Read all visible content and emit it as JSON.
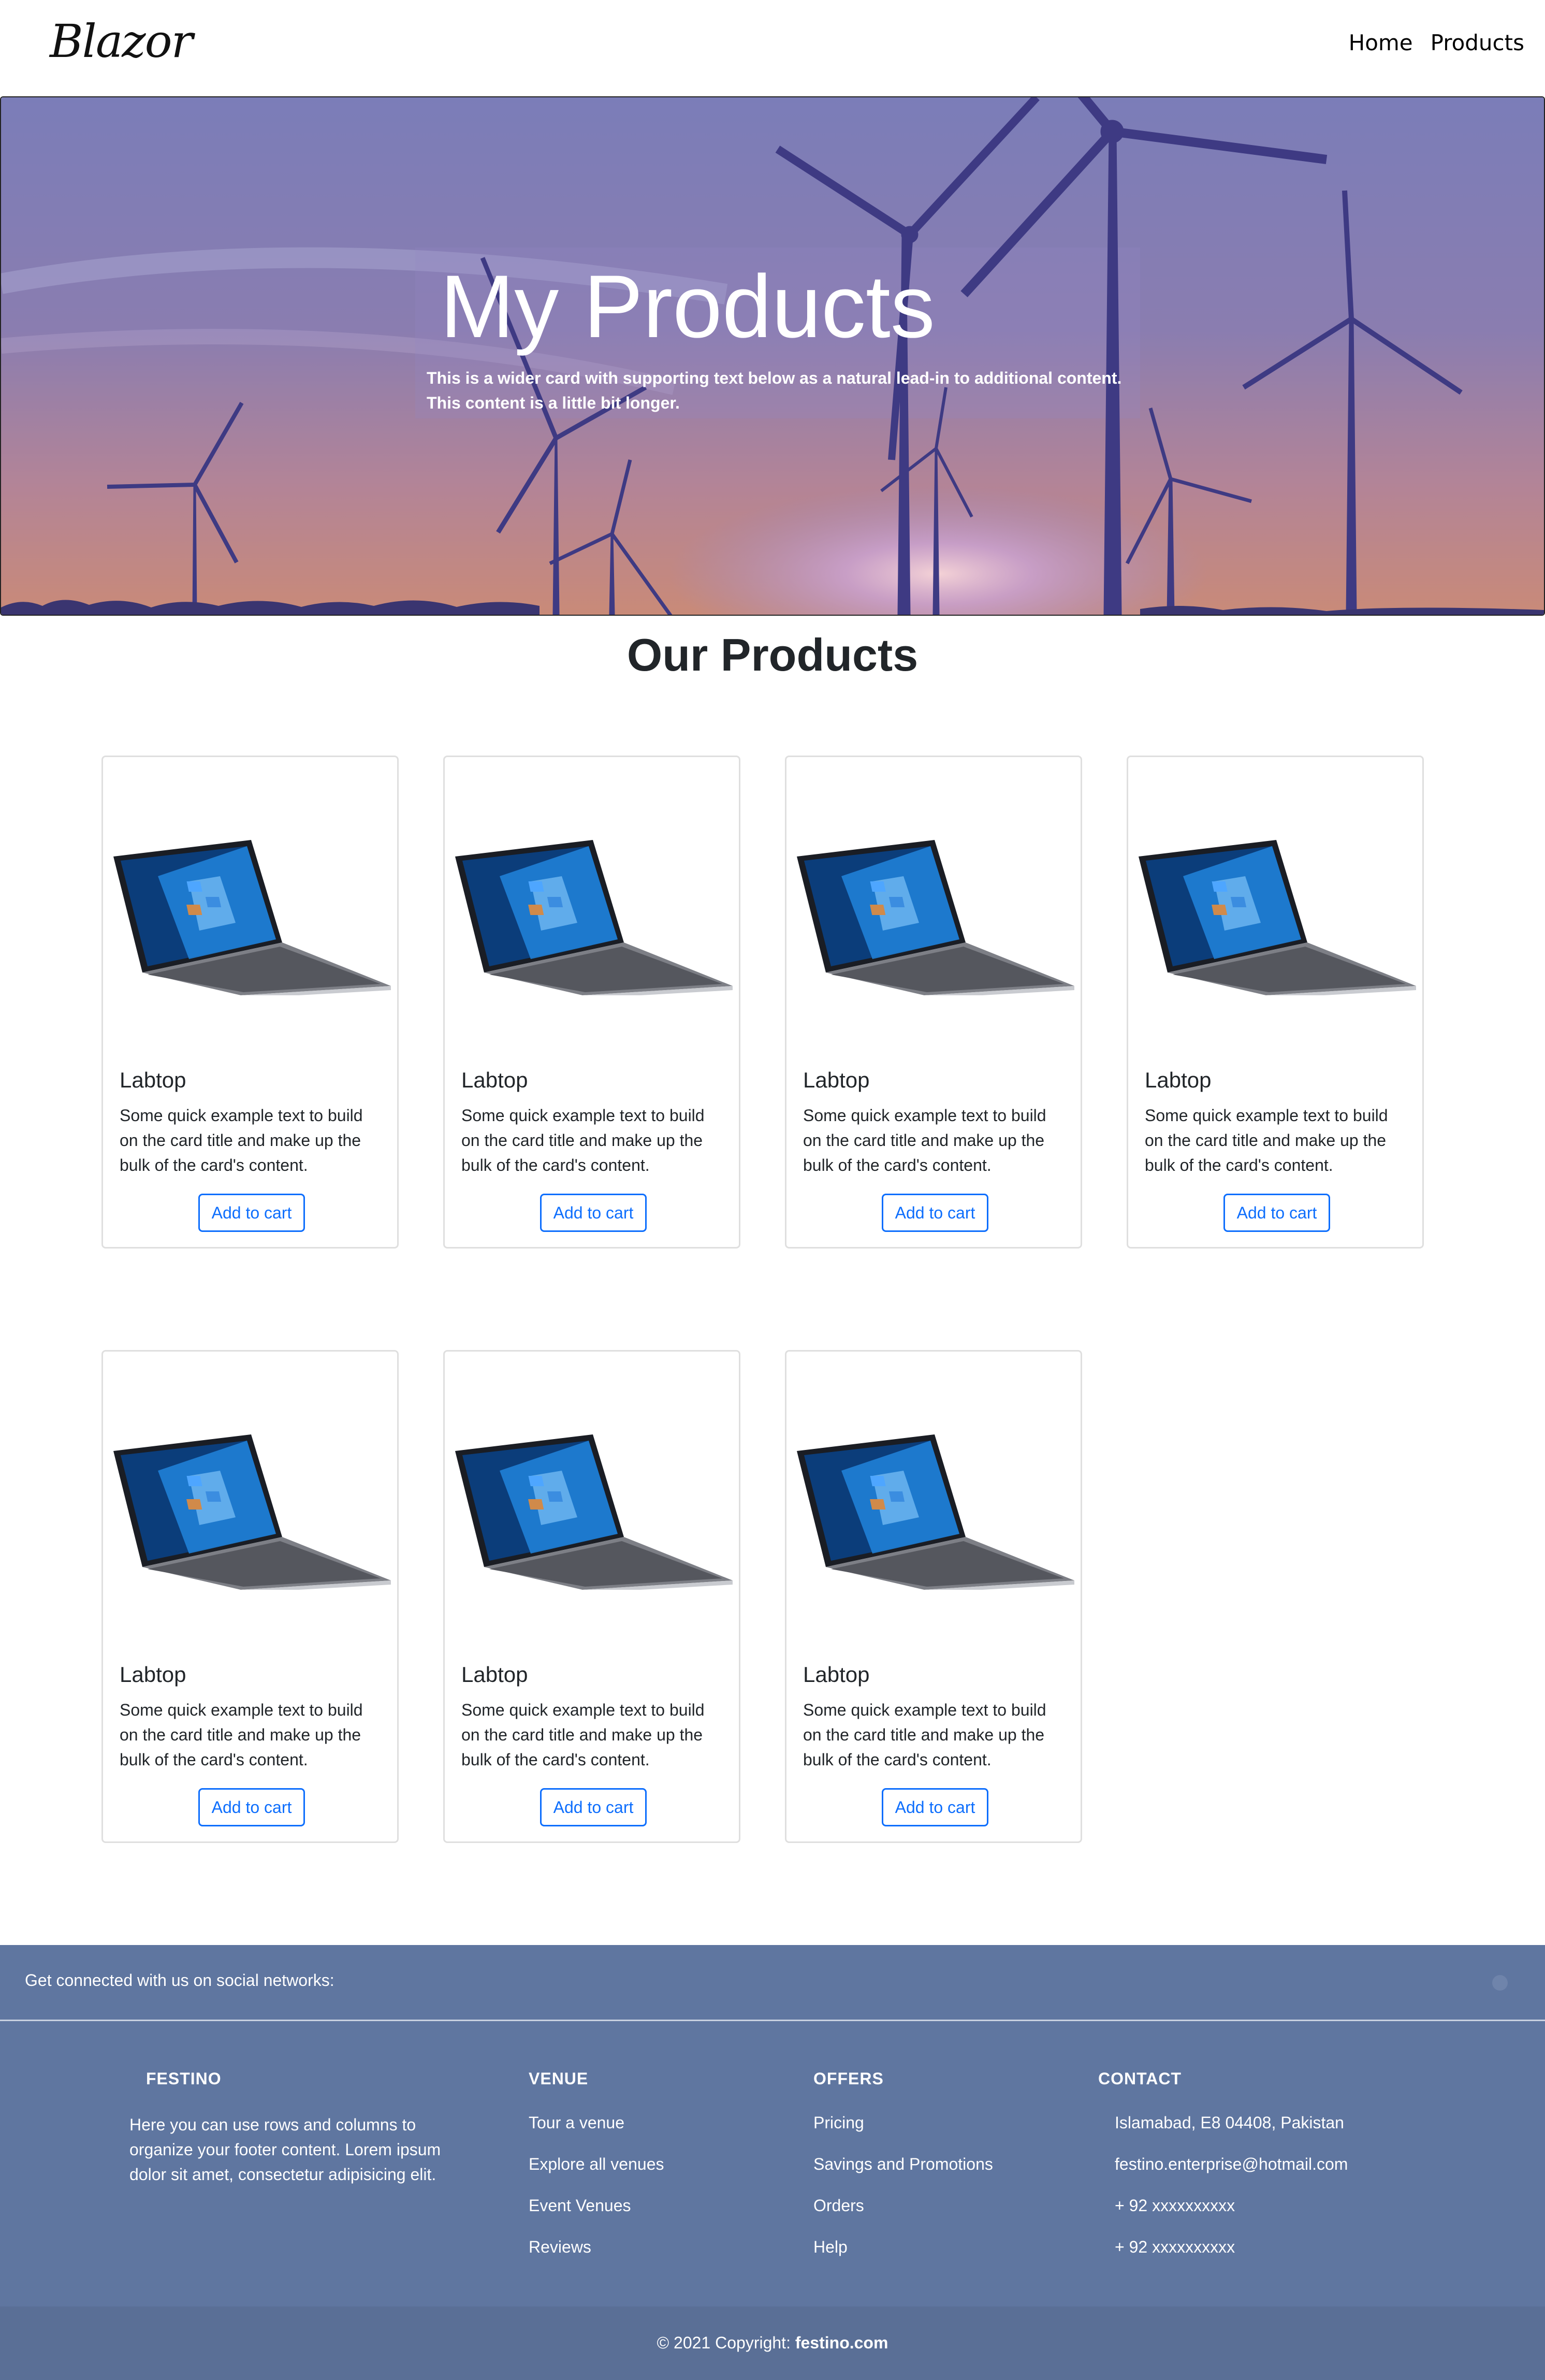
{
  "navbar": {
    "logo": "Blazor",
    "links": [
      "Home",
      "Products"
    ]
  },
  "hero": {
    "title": "My Products",
    "text": "This is a wider card with supporting text below as a natural lead-in to additional content. This content is a little bit longer."
  },
  "section": {
    "title": "Our Products"
  },
  "products": [
    {
      "title": "Labtop",
      "text": "Some quick example text to build on the card title and make up the bulk of the card's content.",
      "button": "Add to cart",
      "image_icon": "laptop-icon"
    },
    {
      "title": "Labtop",
      "text": "Some quick example text to build on the card title and make up the bulk of the card's content.",
      "button": "Add to cart",
      "image_icon": "laptop-icon"
    },
    {
      "title": "Labtop",
      "text": "Some quick example text to build on the card title and make up the bulk of the card's content.",
      "button": "Add to cart",
      "image_icon": "laptop-icon"
    },
    {
      "title": "Labtop",
      "text": "Some quick example text to build on the card title and make up the bulk of the card's content.",
      "button": "Add to cart",
      "image_icon": "laptop-icon"
    },
    {
      "title": "Labtop",
      "text": "Some quick example text to build on the card title and make up the bulk of the card's content.",
      "button": "Add to cart",
      "image_icon": "laptop-icon"
    },
    {
      "title": "Labtop",
      "text": "Some quick example text to build on the card title and make up the bulk of the card's content.",
      "button": "Add to cart",
      "image_icon": "laptop-icon"
    },
    {
      "title": "Labtop",
      "text": "Some quick example text to build on the card title and make up the bulk of the card's content.",
      "button": "Add to cart",
      "image_icon": "laptop-icon"
    }
  ],
  "footer": {
    "social_text": "Get connected with us on social networks:",
    "brand": {
      "heading": "FESTINO",
      "text": "Here you can use rows and columns to organize your footer content. Lorem ipsum dolor sit amet, consectetur adipisicing elit."
    },
    "venue": {
      "heading": "VENUE",
      "items": [
        "Tour a venue",
        "Explore all venues",
        "Event Venues",
        "Reviews"
      ]
    },
    "offers": {
      "heading": "OFFERS",
      "items": [
        "Pricing",
        "Savings and Promotions",
        "Orders",
        "Help"
      ]
    },
    "contact": {
      "heading": "CONTACT",
      "items": [
        "Islamabad, E8 04408, Pakistan",
        "festino.enterprise@hotmail.com",
        "+ 92 xxxxxxxxxx",
        "+ 92 xxxxxxxxxx"
      ]
    },
    "copyright_prefix": "© 2021 Copyright: ",
    "copyright_brand": "festino.com"
  },
  "colors": {
    "accent": "#0d6efd",
    "footer": "#5f76a0",
    "copyright_bar": "#5a6f96"
  }
}
